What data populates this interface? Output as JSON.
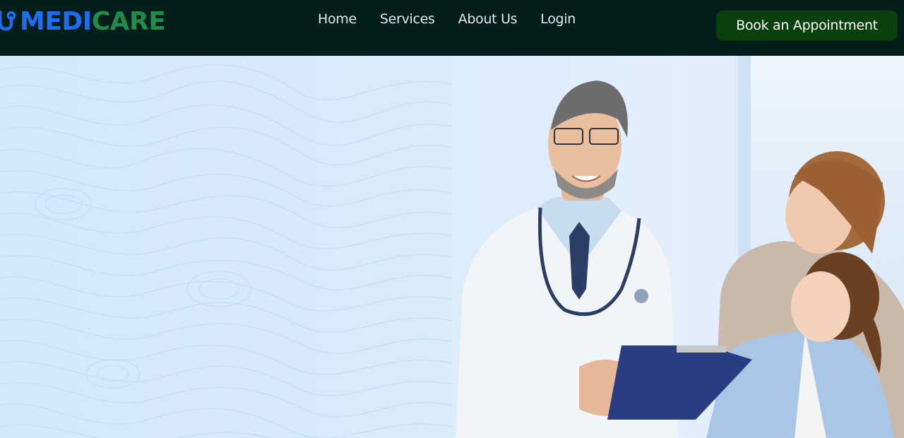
{
  "brand": {
    "name_part1": "MEDI",
    "name_part2": "CARE",
    "colors": {
      "primary_blue": "#1d6ff2",
      "primary_green": "#1f8b4c"
    },
    "icon": "stethoscope-icon"
  },
  "nav": {
    "links": [
      {
        "label": "Home"
      },
      {
        "label": "Services"
      },
      {
        "label": "About Us"
      },
      {
        "label": "Login"
      }
    ],
    "cta_label": "Book an Appointment",
    "background_color": "#031e1a",
    "cta_color": "#0a3f0e"
  },
  "hero": {
    "background_color": "#d9ebfb",
    "image": "doctor-with-mother-and-daughter-photo"
  }
}
